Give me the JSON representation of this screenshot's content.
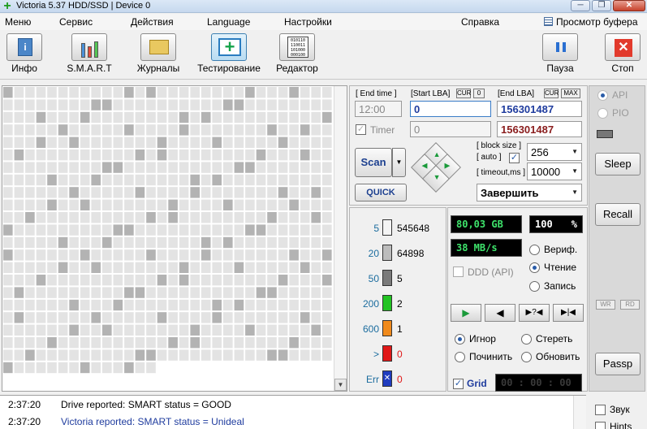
{
  "window": {
    "title": "Victoria 5.37 HDD/SSD | Device 0",
    "min": "─",
    "max": "❐",
    "close": "✕"
  },
  "menu": {
    "items": [
      "Меню",
      "Сервис",
      "Действия",
      "Language",
      "Настройки",
      "Справка"
    ],
    "buffer_view": "Просмотр буфера"
  },
  "toolbar": {
    "info": "Инфо",
    "smart": "S.M.A.R.T",
    "journals": "Журналы",
    "testing": "Тестирование",
    "editor": "Редактор",
    "pause": "Пауза",
    "stop": "Стоп",
    "info_glyph": "i",
    "stop_glyph": "✕",
    "editor_glyph": "010110 110011 101000 000100"
  },
  "lba": {
    "end_time_label": "[ End time ]",
    "start_lba_label": "[Start LBA]",
    "cur1": "CUR",
    "zero": "0",
    "end_lba_label": "[End LBA]",
    "cur2": "CUR",
    "max": "MAX",
    "time_value": "12:00",
    "start_lba": "0",
    "end_lba": "156301487",
    "timer_label": "Timer",
    "timer_value": "0",
    "end_lba_2": "156301487",
    "block_size_label": "[ block size ]",
    "auto_label": "[ auto ]",
    "block_size": "256",
    "timeout_label": "[ timeout,ms ]",
    "timeout": "10000",
    "action": "Завершить",
    "scan": "Scan",
    "quick": "QUICK"
  },
  "stats": [
    {
      "threshold": "5",
      "count": "545648",
      "color": "#f4f4f4"
    },
    {
      "threshold": "20",
      "count": "64898",
      "color": "#bcbcbc"
    },
    {
      "threshold": "50",
      "count": "5",
      "color": "#7a7a7a"
    },
    {
      "threshold": "200",
      "count": "2",
      "color": "#22c322"
    },
    {
      "threshold": "600",
      "count": "1",
      "color": "#f08a1c"
    },
    {
      "threshold": ">",
      "count": "0",
      "color": "#e01818"
    },
    {
      "threshold": "Err",
      "count": "0",
      "color": "#1f3cbf"
    }
  ],
  "status": {
    "scanned": "80,03 GB",
    "percent": "100",
    "percent_unit": "%",
    "speed": "38 MB/s",
    "ddd": "DDD (API)",
    "verify": "Вериф.",
    "read": "Чтение",
    "write": "Запись",
    "ignore": "Игнор",
    "erase": "Стереть",
    "repair": "Починить",
    "refresh": "Обновить",
    "grid": "Grid",
    "timer": "00 : 00 : 00",
    "play_glyph": "▶",
    "back_glyph": "◀",
    "skip_glyph": "▶?◀",
    "end_glyph": "▶|◀"
  },
  "side": {
    "api": "API",
    "pio": "PIO",
    "sleep": "Sleep",
    "recall": "Recall",
    "wr": "WR",
    "rd": "RD",
    "passp": "Passp",
    "sound": "Звук",
    "hints": "Hints"
  },
  "log": [
    {
      "time": "2:37:20",
      "msg": "Drive reported: SMART status = GOOD",
      "color": "#000000"
    },
    {
      "time": "2:37:20",
      "msg": "Victoria reported: SMART status = Unideal",
      "color": "#1f3c9e"
    }
  ],
  "colors": {
    "accent": "#2a5ca8",
    "lcd_green": "#3ee36b"
  }
}
